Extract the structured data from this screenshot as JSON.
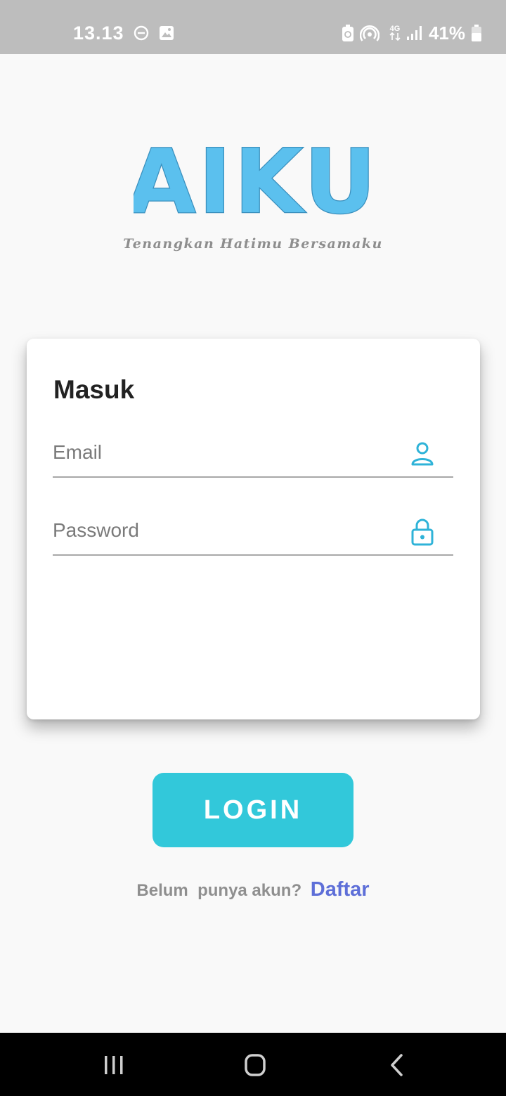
{
  "status_bar": {
    "time": "13.13",
    "network": "4G",
    "battery": "41%",
    "icons": [
      "do-not-disturb-icon",
      "gallery-icon",
      "battery-saver-icon",
      "hotspot-icon",
      "signal-icon",
      "battery-icon"
    ]
  },
  "logo": {
    "text": "AIKU",
    "tagline": "Tenangkan Hatimu Bersamaku",
    "color": "#5bc0ee"
  },
  "login_card": {
    "title": "Masuk",
    "email_placeholder": "Email",
    "email_icon": "user-icon",
    "password_placeholder": "Password",
    "password_icon": "lock-icon"
  },
  "login_button": {
    "label": "LOGIN",
    "color": "#32c8da"
  },
  "register": {
    "prompt": "Belum  punya akun?",
    "link": "Daftar",
    "link_color": "#5e6fd8"
  },
  "nav_bar": {
    "icons": [
      "recent-apps-icon",
      "home-icon",
      "back-icon"
    ]
  }
}
